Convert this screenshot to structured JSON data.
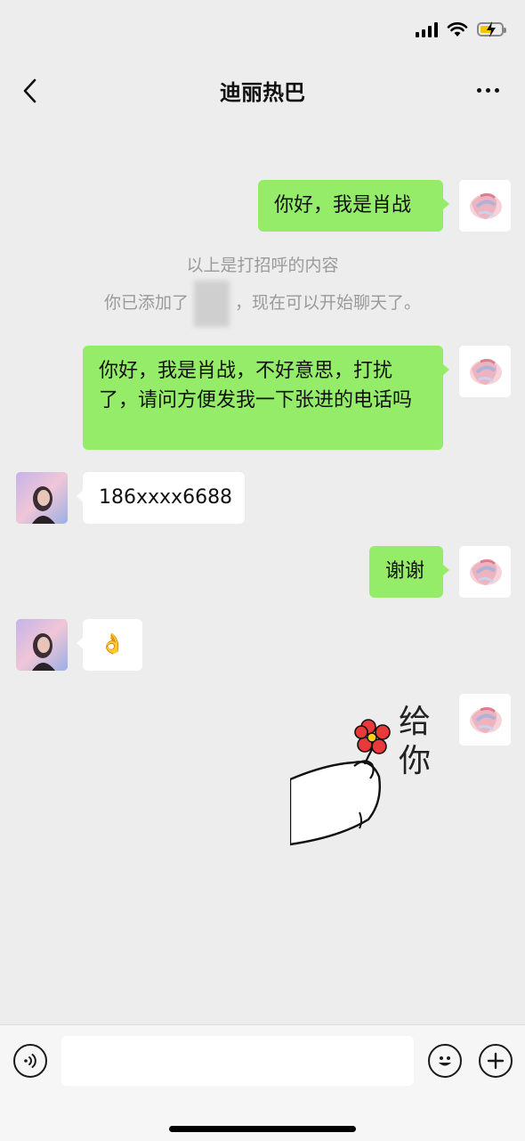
{
  "nav": {
    "title": "迪丽热巴"
  },
  "messages": {
    "m1": "你好，我是肖战",
    "m2": "你好，我是肖战，不好意思，打扰了，请问方便发我一下张进的电话吗",
    "m3": "186xxxx6688",
    "m4": "谢谢",
    "m5": "👌"
  },
  "system": {
    "greeting_note": "以上是打招呼的内容",
    "added_prefix": "你已添加了",
    "added_suffix": "，现在可以开始聊天了。"
  },
  "sticker": {
    "text_line1": "给",
    "text_line2": "你"
  },
  "composer": {
    "placeholder": ""
  },
  "colors": {
    "sent_bubble": "#95ec69",
    "received_bubble": "#ffffff",
    "background": "#ededed"
  },
  "icons": [
    "signal-icon",
    "wifi-icon",
    "battery-charging-icon",
    "back-chevron-icon",
    "more-dots-icon",
    "voice-icon",
    "emoji-icon",
    "plus-icon",
    "flower-sticker"
  ]
}
